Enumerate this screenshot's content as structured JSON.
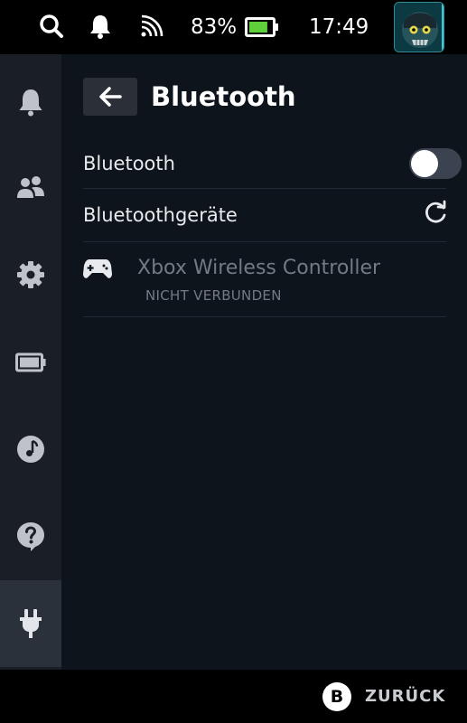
{
  "status_bar": {
    "battery_percent": "83%",
    "battery_level": 0.83,
    "time": "17:49",
    "icons": [
      "search-icon",
      "bell-icon",
      "wifi-icon",
      "battery-icon"
    ]
  },
  "sidebar": {
    "items": [
      {
        "icon": "bell-icon",
        "active": false
      },
      {
        "icon": "friends-icon",
        "active": false
      },
      {
        "icon": "gear-icon",
        "active": false
      },
      {
        "icon": "battery-icon",
        "active": false
      },
      {
        "icon": "music-icon",
        "active": false
      },
      {
        "icon": "help-icon",
        "active": false
      },
      {
        "icon": "plug-icon",
        "active": true
      }
    ]
  },
  "page": {
    "title": "Bluetooth"
  },
  "settings": {
    "bluetooth_label": "Bluetooth",
    "bluetooth_enabled": true,
    "devices_label": "Bluetoothgeräte"
  },
  "devices": [
    {
      "name": "Xbox Wireless Controller",
      "status": "NICHT VERBUNDEN",
      "icon": "gamepad-icon"
    }
  ],
  "footer": {
    "button_glyph": "B",
    "back_label": "ZURÜCK"
  },
  "colors": {
    "background": "#0e141b",
    "sidebar": "#1a1f27",
    "sidebar_active": "#2b313b",
    "battery_green": "#5fd03a",
    "muted_text": "#737985"
  }
}
